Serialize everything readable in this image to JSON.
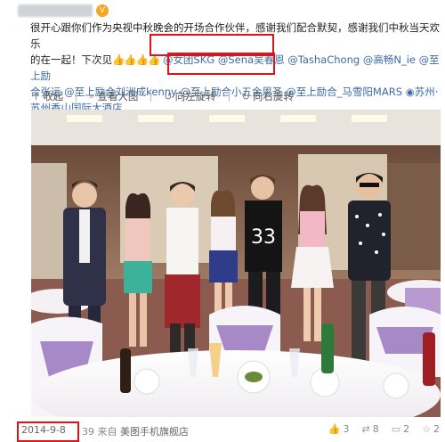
{
  "post": {
    "author_badge": "V",
    "text_line1": "很开心跟你们作为央视中秋晚会的开场合作伙伴，感谢我们配合默契，感谢我们中秋当天欢乐",
    "text_line2_prefix": "的在一起！下次见",
    "text_emojis": "👍👍👍👍",
    "mentions": [
      "@女团SKG",
      "@Sena吴春恩",
      "@TashaChong",
      "@高畅N_ie",
      "@至上励",
      "合张远",
      "@至上励合刘洲成kenny",
      "@至上励合小五金恩圣",
      "@至上励合_马雪阳MARS",
      "苏州·苏州香山国际大酒店"
    ],
    "location_icon": "location-pin-icon"
  },
  "toolbar": {
    "collect": "收起",
    "view_large": "查看大图",
    "rotate_left": "向左旋转",
    "rotate_right": "向右旋转"
  },
  "footer": {
    "date": "2014-9-8",
    "time_suffix": "39",
    "source_prefix": "来自",
    "source": "美图手机旗舰店",
    "like_count": "3",
    "repost_count": "8",
    "comment_count": "2",
    "favorite_count": "2"
  },
  "photo_caption_digits": "33",
  "colors": {
    "highlight": "#e01414",
    "link": "#3a6aa6",
    "chair_bow": "#a889c8"
  }
}
